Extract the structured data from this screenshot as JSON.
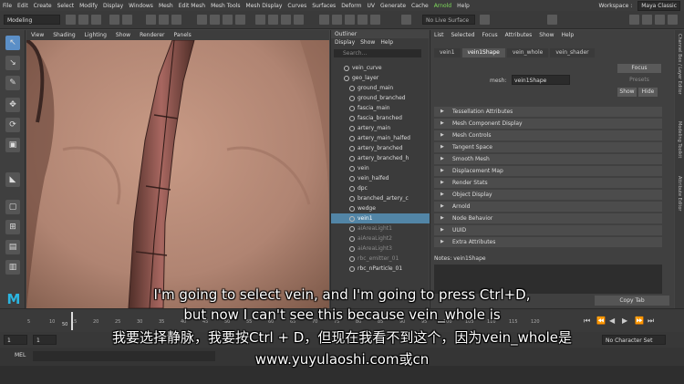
{
  "menubar": {
    "items": [
      "File",
      "Edit",
      "Create",
      "Select",
      "Modify",
      "Display",
      "Windows",
      "Mesh",
      "Edit Mesh",
      "Mesh Tools",
      "Mesh Display",
      "Curves",
      "Surfaces",
      "Deform",
      "UV",
      "Generate",
      "Cache",
      "Arnold",
      "Help"
    ],
    "workspace_label": "Workspace :",
    "workspace_value": "Maya Classic"
  },
  "shelf": {
    "mode": "Modeling",
    "live_surface": "No Live Surface"
  },
  "viewport": {
    "menu": [
      "View",
      "Shading",
      "Lighting",
      "Show",
      "Renderer",
      "Panels"
    ]
  },
  "outliner": {
    "title": "Outliner",
    "menu": [
      "Display",
      "Show",
      "Help"
    ],
    "search_placeholder": "Search...",
    "items": [
      {
        "label": "vein_curve",
        "state": "normal"
      },
      {
        "label": "geo_layer",
        "state": "normal"
      },
      {
        "label": "ground_main",
        "state": "normal"
      },
      {
        "label": "ground_branched",
        "state": "normal"
      },
      {
        "label": "fascia_main",
        "state": "normal"
      },
      {
        "label": "fascia_branched",
        "state": "normal"
      },
      {
        "label": "artery_main",
        "state": "normal"
      },
      {
        "label": "artery_main_halfed",
        "state": "normal"
      },
      {
        "label": "artery_branched",
        "state": "normal"
      },
      {
        "label": "artery_branched_h",
        "state": "normal"
      },
      {
        "label": "vein",
        "state": "normal"
      },
      {
        "label": "vein_halfed",
        "state": "normal"
      },
      {
        "label": "dpc",
        "state": "normal"
      },
      {
        "label": "branched_artery_c",
        "state": "normal"
      },
      {
        "label": "wedge",
        "state": "normal"
      },
      {
        "label": "vein1",
        "state": "selected"
      },
      {
        "label": "aiAreaLight1",
        "state": "dim"
      },
      {
        "label": "aiAreaLight2",
        "state": "dim"
      },
      {
        "label": "aiAreaLight3",
        "state": "dim"
      },
      {
        "label": "rbc_emitter_01",
        "state": "dim"
      },
      {
        "label": "rbc_nParticle_01",
        "state": "normal"
      }
    ]
  },
  "attribute_editor": {
    "menu": [
      "List",
      "Selected",
      "Focus",
      "Attributes",
      "Show",
      "Help"
    ],
    "tabs": [
      "vein1",
      "vein1Shape",
      "vein_whole",
      "vein_shader"
    ],
    "active_tab": "vein1Shape",
    "mesh_label": "mesh:",
    "mesh_value": "vein1Shape",
    "focus_button": "Focus",
    "presets_button": "Presets",
    "show_button": "Show",
    "hide_button": "Hide",
    "sections": [
      "Tessellation Attributes",
      "Mesh Component Display",
      "Mesh Controls",
      "Tangent Space",
      "Smooth Mesh",
      "Displacement Map",
      "Render Stats",
      "Object Display",
      "Arnold",
      "Node Behavior",
      "UUID",
      "Extra Attributes"
    ],
    "notes_label": "Notes: vein1Shape",
    "copy_tab": "Copy Tab"
  },
  "right_strip": [
    "Channel Box / Layer Editor",
    "Modeling Toolkit",
    "Attribute Editor"
  ],
  "timeline": {
    "ticks": [
      "5",
      "10",
      "15",
      "20",
      "25",
      "30",
      "35",
      "40",
      "45",
      "50",
      "55",
      "60",
      "65",
      "70",
      "75",
      "80",
      "85",
      "90",
      "95",
      "100",
      "105",
      "110",
      "115",
      "120"
    ],
    "current_frame": "50"
  },
  "range_slider": {
    "start": "1",
    "playback_start": "1",
    "no_character": "No Character Set"
  },
  "command_line": {
    "label": "MEL"
  },
  "subtitles": {
    "line1": "I'm going to select vein, and I'm going to press Ctrl+D,",
    "line2": "but now I can't see this because vein_whole is",
    "line3": "我要选择静脉，我要按Ctrl + D，但现在我看不到这个，因为vein_whole是",
    "line4": "www.yuyulaoshi.com或cn"
  },
  "logo": {
    "glyph": "M"
  }
}
